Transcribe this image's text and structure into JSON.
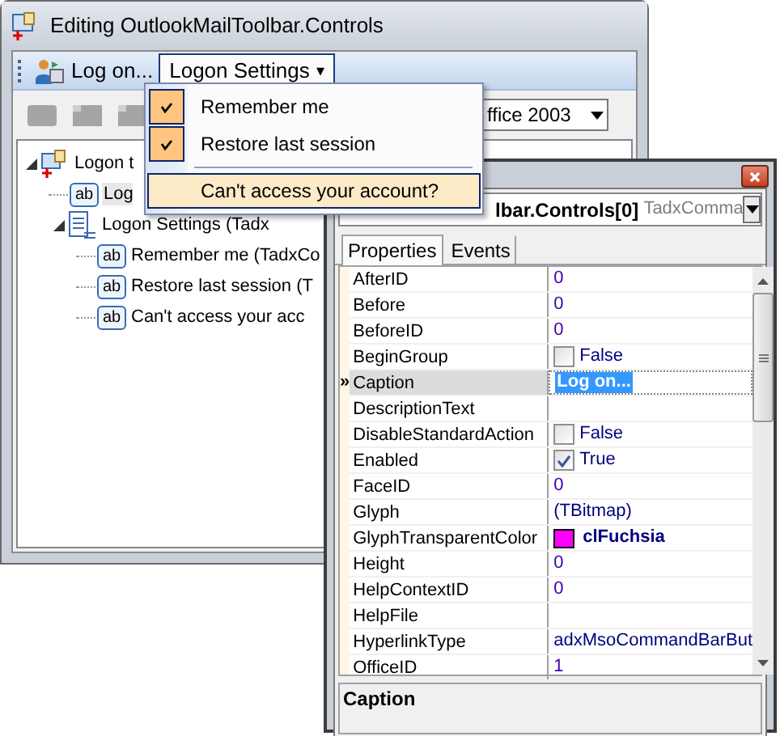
{
  "main_window": {
    "title": "Editing OutlookMailToolbar.Controls",
    "toolbar": [
      {
        "kind": "button",
        "label": "Log on...",
        "selected": false
      },
      {
        "kind": "dropdown",
        "label": "Logon Settings",
        "caret": "▾",
        "selected": true
      }
    ],
    "style_combo": {
      "value": "ffice 2003"
    },
    "tree": [
      {
        "label": "Logon t",
        "kind": "toolbar",
        "expanded": true,
        "selected": false,
        "children": [
          {
            "label": "Log",
            "kind": "button",
            "badge": "ab",
            "selected": true
          },
          {
            "label": "Logon Settings (Tadx",
            "kind": "popup",
            "expanded": true,
            "selected": false,
            "children": [
              {
                "label": "Remember me (TadxCo",
                "kind": "button",
                "badge": "ab",
                "selected": false
              },
              {
                "label": "Restore last session (T",
                "kind": "button",
                "badge": "ab",
                "selected": false
              },
              {
                "label": "Can't access your acc",
                "kind": "button",
                "badge": "ab",
                "selected": false
              }
            ]
          }
        ]
      }
    ]
  },
  "menu": {
    "items": [
      {
        "kind": "item",
        "label": "Remember me",
        "checked": true,
        "selected": false
      },
      {
        "kind": "item",
        "label": "Restore last session",
        "checked": true,
        "selected": false
      },
      {
        "kind": "separator"
      },
      {
        "kind": "item",
        "label": "Can't access your account?",
        "checked": false,
        "selected": true
      }
    ]
  },
  "inspector": {
    "object_name": "lbar.Controls[0]",
    "object_type": "TadxComma",
    "tabs": [
      {
        "label": "Properties",
        "selected": true
      },
      {
        "label": "Events",
        "selected": false
      }
    ],
    "selected_marker": "»",
    "rows": [
      {
        "name": "AfterID",
        "kind": "number",
        "value": "0",
        "selected": false
      },
      {
        "name": "Before",
        "kind": "number",
        "value": "0",
        "selected": false
      },
      {
        "name": "BeforeID",
        "kind": "number",
        "value": "0",
        "selected": false
      },
      {
        "name": "BeginGroup",
        "kind": "checkbox",
        "value": "False",
        "checked": false,
        "selected": false
      },
      {
        "name": "Caption",
        "kind": "text",
        "value": "Log on...",
        "selected": true
      },
      {
        "name": "DescriptionText",
        "kind": "text",
        "selected": false
      },
      {
        "name": "DisableStandardAction",
        "kind": "checkbox",
        "value": "False",
        "checked": false,
        "selected": false
      },
      {
        "name": "Enabled",
        "kind": "checkbox",
        "value": "True",
        "checked": true,
        "selected": false
      },
      {
        "name": "FaceID",
        "kind": "number",
        "value": "0",
        "selected": false
      },
      {
        "name": "Glyph",
        "kind": "text",
        "value": "(TBitmap)",
        "selected": false
      },
      {
        "name": "GlyphTransparentColor",
        "kind": "color",
        "value": "clFuchsia",
        "color": "#ff00ff",
        "selected": false
      },
      {
        "name": "Height",
        "kind": "number",
        "value": "0",
        "selected": false
      },
      {
        "name": "HelpContextID",
        "kind": "number",
        "value": "0",
        "selected": false
      },
      {
        "name": "HelpFile",
        "kind": "text",
        "selected": false
      },
      {
        "name": "HyperlinkType",
        "kind": "text",
        "value": "adxMsoCommandBarBut",
        "selected": false
      },
      {
        "name": "OfficeID",
        "kind": "number",
        "value": "1",
        "selected": false
      }
    ],
    "description": "Caption"
  }
}
